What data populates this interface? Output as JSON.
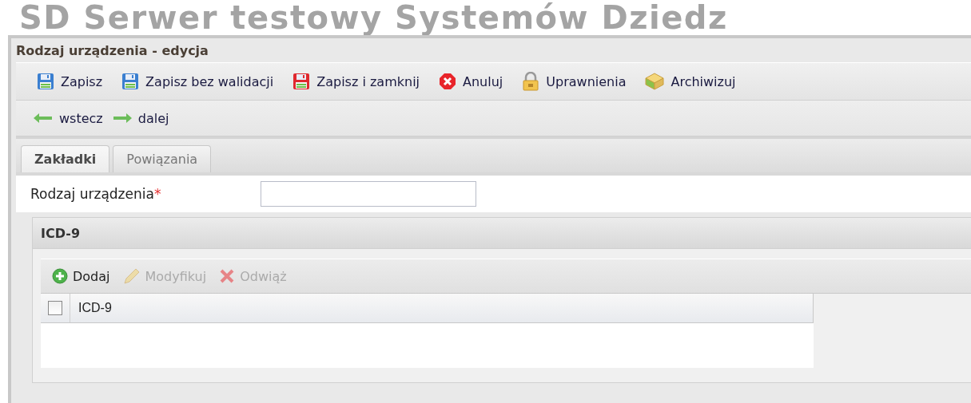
{
  "background_heading": "SD Serwer testowy Systemów Dziedz",
  "window": {
    "title": "Rodzaj urządzenia - edycja"
  },
  "toolbar": [
    {
      "label": "Zapisz",
      "kind": "save"
    },
    {
      "label": "Zapisz bez walidacji",
      "kind": "save"
    },
    {
      "label": "Zapisz i zamknij",
      "kind": "save-close"
    },
    {
      "label": "Anuluj",
      "kind": "cancel"
    },
    {
      "label": "Uprawnienia",
      "kind": "lock"
    },
    {
      "label": "Archiwizuj",
      "kind": "archive"
    }
  ],
  "navigation": [
    {
      "label": "wstecz",
      "kind": "back"
    },
    {
      "label": "dalej",
      "kind": "forward"
    }
  ],
  "tabs": [
    {
      "label": "Zakładki",
      "selected": true
    },
    {
      "label": "Powiązania",
      "selected": false
    }
  ],
  "form": {
    "label": "Rodzaj urządzenia",
    "required_mark": "*"
  },
  "section": {
    "title": "ICD-9",
    "actions": [
      {
        "label": "Dodaj",
        "kind": "add",
        "disabled": false
      },
      {
        "label": "Modyfikuj",
        "kind": "edit",
        "disabled": true
      },
      {
        "label": "Odwiąż",
        "kind": "unlink",
        "disabled": true
      }
    ],
    "grid": {
      "columns": [
        "ICD-9"
      ],
      "header_checked": false
    }
  }
}
